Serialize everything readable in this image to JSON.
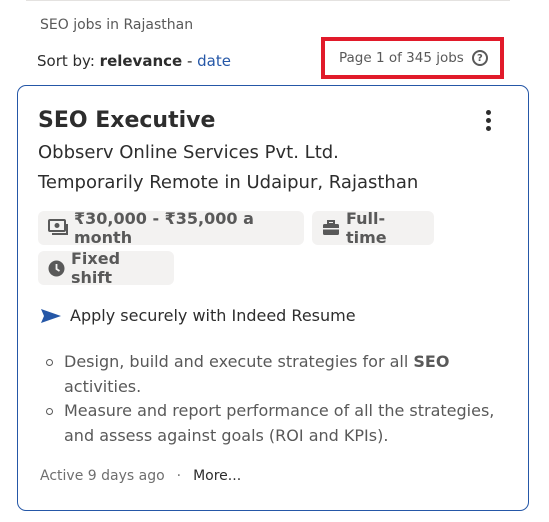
{
  "search": {
    "query_label": "SEO jobs in Rajasthan"
  },
  "sort": {
    "prefix": "Sort by:",
    "active": "relevance",
    "separator": " - ",
    "alternate": "date"
  },
  "pagination": {
    "text": "Page 1 of 345 jobs",
    "help_icon": "question-circle-icon",
    "highlight_color": "#e11a2a"
  },
  "job": {
    "title": "SEO Executive",
    "company": "Obbserv Online Services Pvt. Ltd.",
    "location": "Temporarily Remote in Udaipur, Rajasthan",
    "tags": {
      "salary": "₹30,000 - ₹35,000 a month",
      "type": "Full-time",
      "shift": "Fixed shift"
    },
    "apply": "Apply securely with Indeed Resume",
    "bullets": [
      {
        "pre": "Design, build and execute strategies for all ",
        "bold": "SEO",
        "post": " activities."
      },
      {
        "pre": "Measure and report performance of all the strategies, and assess against goals (ROI and KPIs).",
        "bold": "",
        "post": ""
      }
    ],
    "posted": "Active 9 days ago",
    "dot": "·",
    "more": "More..."
  },
  "colors": {
    "accent": "#2557a7",
    "text": "#2d2d2d",
    "muted": "#595959",
    "tag_bg": "#f3f2f1"
  }
}
